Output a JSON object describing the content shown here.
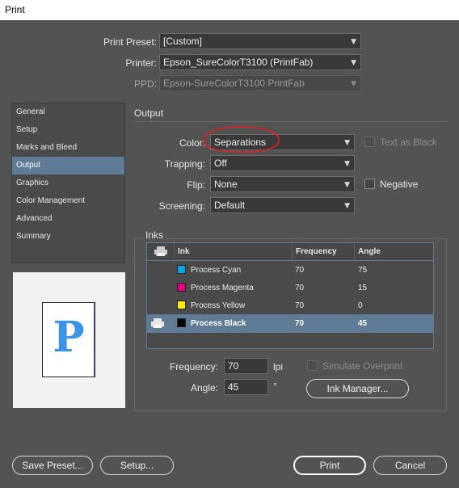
{
  "window": {
    "title": "Print"
  },
  "preset": {
    "print_preset_label": "Print Preset:",
    "print_preset_value": "[Custom]",
    "printer_label": "Printer:",
    "printer_value": "Epson_SureColorT3100 (PrintFab)",
    "ppd_label": "PPD:",
    "ppd_value": "Epson-SureColorT3100 PrintFab"
  },
  "nav": {
    "items": [
      {
        "label": "General"
      },
      {
        "label": "Setup"
      },
      {
        "label": "Marks and Bleed"
      },
      {
        "label": "Output"
      },
      {
        "label": "Graphics"
      },
      {
        "label": "Color Management"
      },
      {
        "label": "Advanced"
      },
      {
        "label": "Summary"
      }
    ],
    "selected": "Output"
  },
  "preview": {
    "page_letter": "P"
  },
  "output": {
    "title": "Output",
    "color_label": "Color:",
    "color_value": "Separations",
    "text_as_black_label": "Text as Black",
    "trapping_label": "Trapping:",
    "trapping_value": "Off",
    "flip_label": "Flip:",
    "flip_value": "None",
    "negative_label": "Negative",
    "screening_label": "Screening:",
    "screening_value": "Default"
  },
  "inks": {
    "title": "Inks",
    "columns": {
      "ink": "Ink",
      "frequency": "Frequency",
      "angle": "Angle"
    },
    "rows": [
      {
        "name": "Process Cyan",
        "frequency": "70",
        "angle": "75",
        "color": "#00a8e8"
      },
      {
        "name": "Process Magenta",
        "frequency": "70",
        "angle": "15",
        "color": "#e0007a"
      },
      {
        "name": "Process Yellow",
        "frequency": "70",
        "angle": "0",
        "color": "#ffee00"
      },
      {
        "name": "Process Black",
        "frequency": "70",
        "angle": "45",
        "color": "#000000"
      }
    ],
    "frequency_label": "Frequency:",
    "frequency_value": "70",
    "frequency_unit": "lpi",
    "angle_label": "Angle:",
    "angle_value": "45",
    "angle_unit": "°",
    "simulate_overprint_label": "Simulate Overprint",
    "ink_manager_label": "Ink Manager..."
  },
  "footer": {
    "save_preset_label": "Save Preset...",
    "setup_label": "Setup...",
    "print_label": "Print",
    "cancel_label": "Cancel"
  },
  "colors": {
    "accent": "#5f7b95",
    "annotation": "#e02020"
  }
}
